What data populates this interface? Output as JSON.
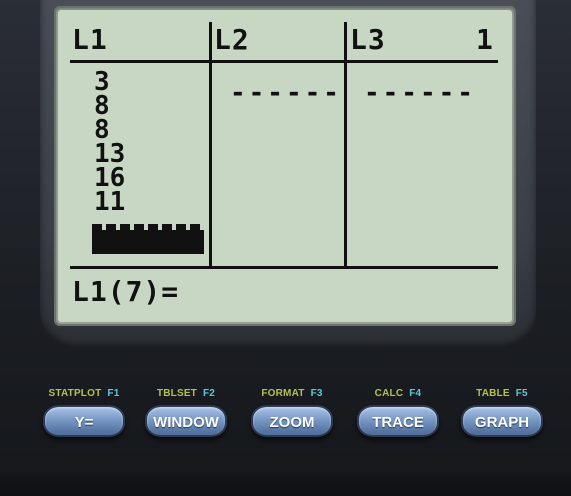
{
  "screen": {
    "headers": {
      "l1": "L1",
      "l2": "L2",
      "l3": "L3",
      "column_number": "1"
    },
    "l1_values": [
      "3",
      "8",
      "8",
      "13",
      "16",
      "11"
    ],
    "l2_placeholder": "------",
    "l3_placeholder": "------",
    "entry_line": "L1(7)="
  },
  "keys": [
    {
      "secondary": "STATPLOT",
      "fkey": "F1",
      "label": "Y="
    },
    {
      "secondary": "TBLSET",
      "fkey": "F2",
      "label": "WINDOW"
    },
    {
      "secondary": "FORMAT",
      "fkey": "F3",
      "label": "ZOOM"
    },
    {
      "secondary": "CALC",
      "fkey": "F4",
      "label": "TRACE"
    },
    {
      "secondary": "TABLE",
      "fkey": "F5",
      "label": "GRAPH"
    }
  ],
  "colors": {
    "lcd_background": "#c8d6c4",
    "lcd_ink": "#111111",
    "button_blue": "#6f8fbd",
    "secondary_label": "#b7c04a",
    "fkey_label": "#5ec8d8"
  }
}
